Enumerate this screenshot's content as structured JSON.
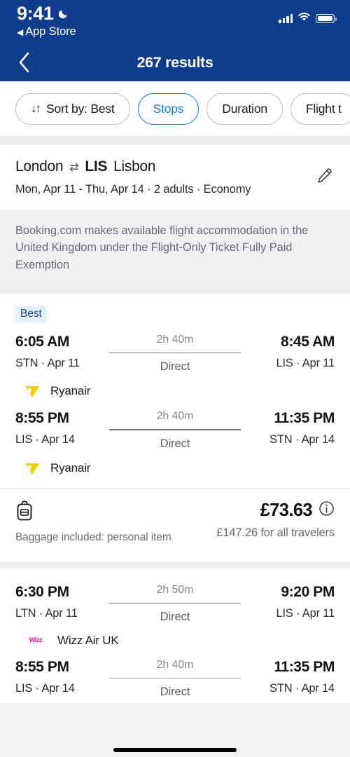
{
  "status_bar": {
    "time": "9:41",
    "moon_icon": "moon-icon",
    "back_app_label": "App Store",
    "cellular_icon": "cellular-bars-icon",
    "wifi_icon": "wifi-icon",
    "battery_icon": "battery-full-icon"
  },
  "header": {
    "back_icon": "chevron-left-icon",
    "title": "267 results",
    "background_color": "#0f3d8c"
  },
  "filters": {
    "chips": [
      {
        "label": "Sort by: Best",
        "glyph": "↓↑",
        "icon": "sort-icon",
        "active": false
      },
      {
        "label": "Stops",
        "active": true
      },
      {
        "label": "Duration",
        "active": false
      },
      {
        "label": "Flight t",
        "active": false
      }
    ],
    "active_color": "#1a7ed6"
  },
  "search_summary": {
    "origin": "London",
    "swap_icon": "⇄",
    "destination_code": "LIS",
    "destination_city": "Lisbon",
    "details": "Mon, Apr 11 - Thu, Apr 14 · 2 adults · Economy",
    "edit_icon": "pencil-edit-icon"
  },
  "disclaimer": {
    "text": "Booking.com makes available flight accommodation in the United Kingdom under the Flight-Only Ticket Fully Paid Exemption"
  },
  "results": [
    {
      "badge": "Best",
      "legs": [
        {
          "depart_time": "6:05 AM",
          "depart_sub": "STN · Apr 11",
          "duration": "2h 40m",
          "stops": "Direct",
          "arrive_time": "8:45 AM",
          "arrive_sub": "LIS · Apr 11",
          "airline": "Ryanair",
          "airline_logo": "ryanair-logo-icon"
        },
        {
          "depart_time": "8:55 PM",
          "depart_sub": "LIS · Apr 14",
          "duration": "2h 40m",
          "stops": "Direct",
          "arrive_time": "11:35 PM",
          "arrive_sub": "STN · Apr 14",
          "airline": "Ryanair",
          "airline_logo": "ryanair-logo-icon"
        }
      ],
      "baggage_icon": "backpack-icon",
      "baggage_label": "Baggage included: personal item",
      "price": "£73.63",
      "price_info_icon": "info-circle-icon",
      "price_all": "£147.26 for all travelers"
    },
    {
      "badge": "",
      "legs": [
        {
          "depart_time": "6:30 PM",
          "depart_sub": "LTN · Apr 11",
          "duration": "2h 50m",
          "stops": "Direct",
          "arrive_time": "9:20 PM",
          "arrive_sub": "LIS · Apr 11",
          "airline": "Wizz Air UK",
          "airline_logo": "wizzair-logo-icon",
          "airline_logo_text": "Wizz"
        },
        {
          "depart_time": "8:55 PM",
          "depart_sub": "LIS · Apr 14",
          "duration": "2h 40m",
          "stops": "Direct",
          "arrive_time": "11:35 PM",
          "arrive_sub": "STN · Apr 14",
          "airline": "",
          "airline_logo": ""
        }
      ]
    }
  ],
  "home_indicator": "home-indicator"
}
